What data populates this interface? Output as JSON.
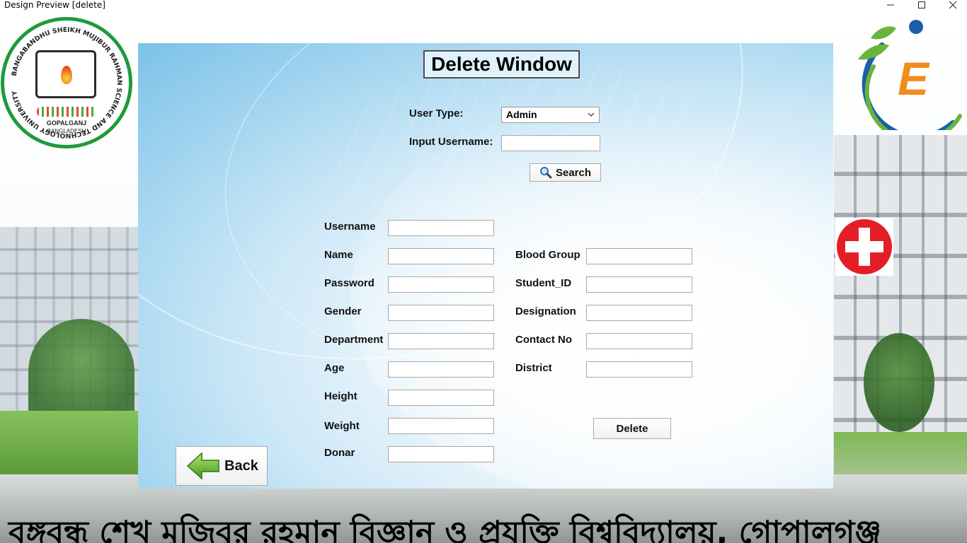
{
  "window": {
    "title": "Design Preview [delete]"
  },
  "heading": "Delete Window",
  "search": {
    "user_type_label": "User Type:",
    "user_type_value": "Admin",
    "username_label": "Input Username:",
    "username_value": "",
    "search_button": "Search"
  },
  "form": {
    "left": [
      {
        "label": "Username",
        "value": ""
      },
      {
        "label": "Name",
        "value": ""
      },
      {
        "label": "Password",
        "value": ""
      },
      {
        "label": "Gender",
        "value": ""
      },
      {
        "label": "Department",
        "value": ""
      },
      {
        "label": "Age",
        "value": ""
      },
      {
        "label": "Height",
        "value": ""
      },
      {
        "label": "Weight",
        "value": ""
      },
      {
        "label": "Donar",
        "value": ""
      }
    ],
    "right": [
      {
        "label": "Blood Group",
        "value": ""
      },
      {
        "label": "Student_ID",
        "value": ""
      },
      {
        "label": "Designation",
        "value": ""
      },
      {
        "label": "Contact No",
        "value": ""
      },
      {
        "label": "District",
        "value": ""
      }
    ]
  },
  "buttons": {
    "delete": "Delete",
    "back": "Back"
  },
  "logos": {
    "university_ring_text": "BANGABANDHU SHEIKH MUJIBUR RAHMAN SCIENCE AND TECHNOLOGY UNIVERSITY",
    "university_city": "GOPALGANJ",
    "university_country": "BANGLADESH",
    "app_logo_letter": "E"
  },
  "banner_text": "বঙ্গবন্ধু শেখ মুজিবুর রহমান বিজ্ঞান ও প্রযুক্তি বিশ্ববিদ্যালয়, গোপালগঞ্জ",
  "colors": {
    "university_green": "#1f9a3a",
    "medical_red": "#e41e26",
    "logo_orange": "#f28c1c",
    "logo_blue": "#1b5fa8",
    "panel_blue": "#7cc2e8"
  },
  "icons": {
    "search": "search-icon",
    "back": "left-arrow-icon",
    "dropdown": "chevron-down-icon",
    "medical": "medical-cross-icon"
  }
}
